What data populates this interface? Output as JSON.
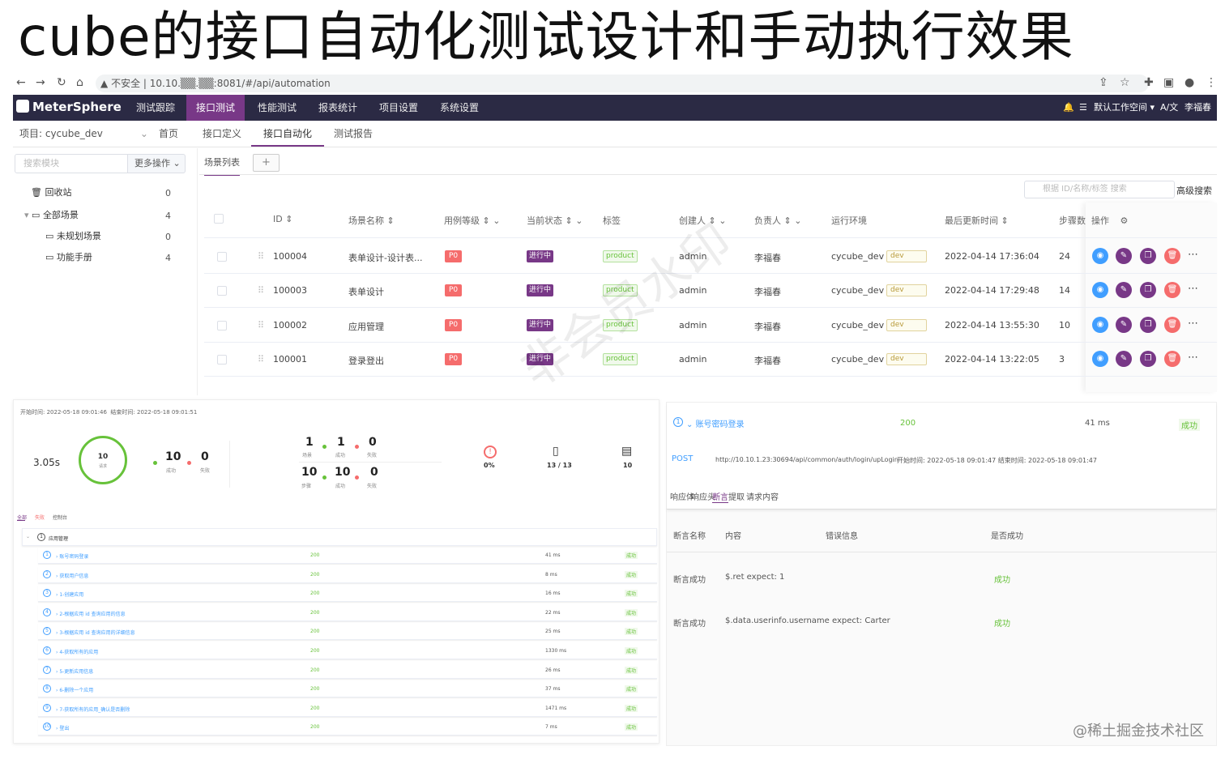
{
  "slide_title": "cube的接口自动化测试设计和手动执行效果",
  "browser": {
    "warning": "不安全",
    "url": "10.10.▒▒.▒▒:8081/#/api/automation"
  },
  "app": {
    "logo": "MeterSphere",
    "nav": [
      "测试跟踪",
      "接口测试",
      "性能测试",
      "报表统计",
      "项目设置",
      "系统设置"
    ],
    "nav_active": "接口测试",
    "workspace": "默认工作空间",
    "lang": "A/文",
    "user": "李福春"
  },
  "subnav": {
    "project": "项目: cycube_dev",
    "items": [
      "首页",
      "接口定义",
      "接口自动化",
      "测试报告"
    ],
    "active": "接口自动化"
  },
  "left": {
    "search_placeholder": "搜索模块",
    "more_ops": "更多操作",
    "tree": [
      {
        "label": "回收站",
        "count": "0"
      },
      {
        "label": "全部场景",
        "count": "4"
      },
      {
        "label": "未规划场景",
        "count": "0"
      },
      {
        "label": "功能手册",
        "count": "4"
      }
    ]
  },
  "main": {
    "tab": "场景列表",
    "add": "+",
    "search_placeholder": "根据 ID/名称/标签 搜索",
    "advanced": "高级搜索",
    "headers": [
      "ID",
      "场景名称",
      "用例等级",
      "当前状态",
      "标签",
      "创建人",
      "负责人",
      "运行环境",
      "最后更新时间",
      "步骤数",
      "操作"
    ],
    "rows": [
      {
        "id": "100004",
        "name": "表单设计-设计表...",
        "level": "P0",
        "status": "进行中",
        "tag": "product",
        "creator": "admin",
        "owner": "李福春",
        "env": "cycube_dev",
        "env_tag": "dev",
        "updated": "2022-04-14 17:36:04",
        "steps": "24"
      },
      {
        "id": "100003",
        "name": "表单设计",
        "level": "P0",
        "status": "进行中",
        "tag": "product",
        "creator": "admin",
        "owner": "李福春",
        "env": "cycube_dev",
        "env_tag": "dev",
        "updated": "2022-04-14 17:29:48",
        "steps": "14"
      },
      {
        "id": "100002",
        "name": "应用管理",
        "level": "P0",
        "status": "进行中",
        "tag": "product",
        "creator": "admin",
        "owner": "李福春",
        "env": "cycube_dev",
        "env_tag": "dev",
        "updated": "2022-04-14 13:55:30",
        "steps": "10"
      },
      {
        "id": "100001",
        "name": "登录登出",
        "level": "P0",
        "status": "进行中",
        "tag": "product",
        "creator": "admin",
        "owner": "李福春",
        "env": "cycube_dev",
        "env_tag": "dev",
        "updated": "2022-04-14 13:22:05",
        "steps": "3"
      }
    ]
  },
  "report": {
    "start_label": "开始时间:",
    "start": "2022-05-18 09:01:46",
    "end_label": "结束时间:",
    "end": "2022-05-18 09:01:51",
    "duration": "3.05s",
    "requests": "10",
    "requests_label": "请求",
    "success": "10",
    "success_label": "成功",
    "fail": "0",
    "fail_label": "失败",
    "scenes_total": "1",
    "scenes_label": "场景",
    "scenes_ok": "1",
    "scenes_fail": "0",
    "steps_total": "10",
    "steps_label": "步骤",
    "steps_ok": "10",
    "steps_fail": "0",
    "err_rate": "0%",
    "assert": "13 / 13",
    "req_count": "10",
    "tabs": [
      "全部",
      "失败",
      "控制台"
    ],
    "group": "应用管理",
    "steps": [
      {
        "n": "1",
        "name": "账号密码登录",
        "code": "200",
        "ms": "41 ms",
        "res": "成功"
      },
      {
        "n": "2",
        "name": "获取用户信息",
        "code": "200",
        "ms": "8 ms",
        "res": "成功"
      },
      {
        "n": "3",
        "name": "1-创建应用",
        "code": "200",
        "ms": "16 ms",
        "res": "成功"
      },
      {
        "n": "4",
        "name": "2-根据应用 id 查询应用的信息",
        "code": "200",
        "ms": "22 ms",
        "res": "成功"
      },
      {
        "n": "5",
        "name": "3-根据应用 id 查询应用的详细信息",
        "code": "200",
        "ms": "25 ms",
        "res": "成功"
      },
      {
        "n": "6",
        "name": "4-获取所有的应用",
        "code": "200",
        "ms": "1330 ms",
        "res": "成功"
      },
      {
        "n": "7",
        "name": "5-更新应用信息",
        "code": "200",
        "ms": "26 ms",
        "res": "成功"
      },
      {
        "n": "8",
        "name": "6-删除一个应用",
        "code": "200",
        "ms": "37 ms",
        "res": "成功"
      },
      {
        "n": "9",
        "name": "7-获取所有的应用_确认是否删除",
        "code": "200",
        "ms": "1471 ms",
        "res": "成功"
      },
      {
        "n": "10",
        "name": "登出",
        "code": "200",
        "ms": "7 ms",
        "res": "成功"
      }
    ]
  },
  "detail": {
    "title": "账号密码登录",
    "code": "200",
    "ms": "41 ms",
    "res": "成功",
    "method": "POST",
    "url": "http://10.10.1.23:30694/api/common/auth/login/upLogin",
    "times": "开始时间: 2022-05-18 09:01:47  结束时间: 2022-05-18 09:01:47",
    "tabs": [
      "响应体",
      "响应头",
      "断言",
      "提取",
      "请求内容"
    ],
    "cols": [
      "断言名称",
      "内容",
      "错误信息",
      "是否成功"
    ],
    "asserts": [
      {
        "name": "断言成功",
        "content": "$.ret expect: 1",
        "ok": "成功"
      },
      {
        "name": "断言成功",
        "content": "$.data.userinfo.username expect: Carter",
        "ok": "成功"
      }
    ]
  },
  "watermark": "非会员水印",
  "credit": "@稀土掘金技术社区"
}
